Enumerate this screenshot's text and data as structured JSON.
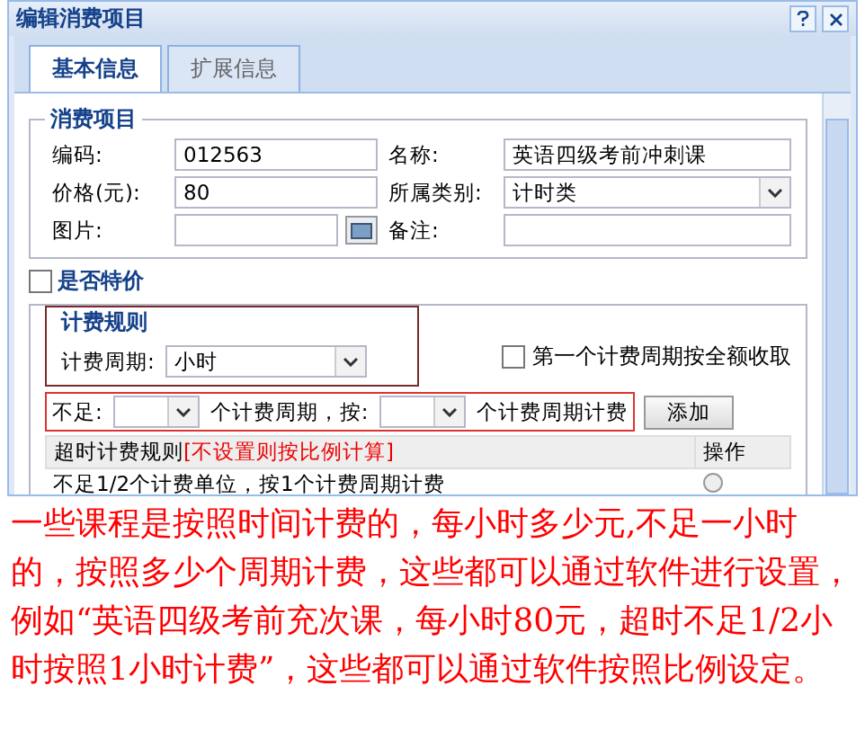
{
  "window": {
    "title": "编辑消费项目"
  },
  "tabs": [
    {
      "label": "基本信息",
      "selected": true
    },
    {
      "label": "扩展信息",
      "selected": false
    }
  ],
  "item_section": {
    "legend": "消费项目",
    "fields": [
      {
        "label": "编码:",
        "value": "012563",
        "kind": "text"
      },
      {
        "label": "名称:",
        "value": "英语四级考前冲刺课",
        "kind": "text"
      },
      {
        "label": "价格(元):",
        "value": "80",
        "kind": "text"
      },
      {
        "label": "所属类别:",
        "value": "计时类",
        "kind": "select"
      },
      {
        "label": "图片:",
        "kind": "file"
      },
      {
        "label": "备注:",
        "kind": "text"
      }
    ]
  },
  "special_price": {
    "label": "是否特价",
    "checked": false
  },
  "billing_rule": {
    "legend": "计费规则",
    "period_label": "计费周期:",
    "period_value": "小时",
    "first_period_full": {
      "label": "第一个计费周期按全额收取",
      "checked": false
    },
    "shortfall": {
      "label": "不足:",
      "middle": "个计费周期，按:",
      "suffix": "个计费周期计费",
      "button": "添加"
    },
    "table": {
      "columns": [
        {
          "label": "超时计费规则",
          "note": "[不设置则按比例计算]"
        },
        {
          "label": "操作"
        }
      ],
      "rows": [
        {
          "rule": "不足1/2个计费单位，按1个计费周期计费"
        }
      ]
    }
  },
  "annotation": "一些课程是按照时间计费的，每小时多少元,不足一小时的，按照多少个周期计费，这些都可以通过软件进行设置，例如“英语四级考前充次课，每小时80元，超时不足1/2小时按照1小时计费”，这些都可以通过软件按照比例设定。"
}
